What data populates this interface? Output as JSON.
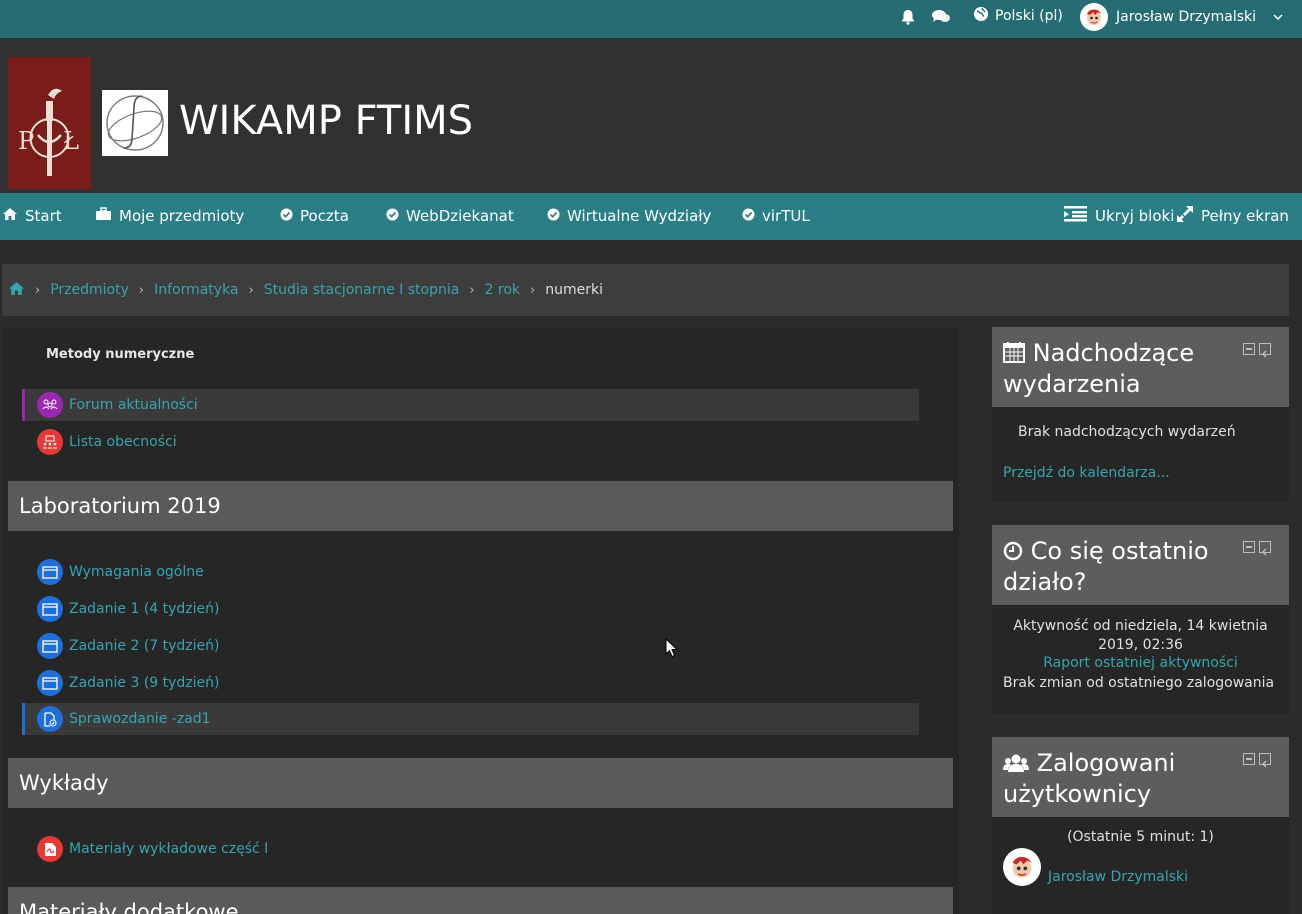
{
  "topbar": {
    "bell_icon": "bell-icon",
    "messages_icon": "chat-icon",
    "language": "Polski (pl)",
    "user_name": "Jarosław Drzymalski"
  },
  "header": {
    "site_title": "WIKAMP FTIMS",
    "logo_pl_text": "PŁ"
  },
  "nav": {
    "items": [
      {
        "label": "Start",
        "icon": "home-icon"
      },
      {
        "label": "Moje przedmioty",
        "icon": "briefcase-icon"
      },
      {
        "label": "Poczta",
        "icon": "check-circle-icon"
      },
      {
        "label": "WebDziekanat",
        "icon": "check-circle-icon"
      },
      {
        "label": "Wirtualne Wydziały",
        "icon": "check-circle-icon"
      },
      {
        "label": "virTUL",
        "icon": "check-circle-icon"
      }
    ],
    "hide_blocks": "Ukryj bloki",
    "fullscreen": "Pełny ekran"
  },
  "breadcrumb": {
    "items": [
      "Przedmioty",
      "Informatyka",
      "Studia stacjonarne I stopnia",
      "2 rok"
    ],
    "current": "numerki"
  },
  "course": {
    "top_title": "Metody numeryczne",
    "top_activities": [
      {
        "label": "Forum aktualności",
        "icon": "forum-icon",
        "color": "#9c27b0"
      },
      {
        "label": "Lista obecności",
        "icon": "attendance-icon",
        "color": "#e53935"
      }
    ],
    "sections": [
      {
        "title": "Laboratorium 2019",
        "activities": [
          {
            "label": "Wymagania ogólne",
            "icon": "page-icon",
            "color": "#1e6fd9"
          },
          {
            "label": "Zadanie 1 (4 tydzień)",
            "icon": "page-icon",
            "color": "#1e6fd9"
          },
          {
            "label": "Zadanie 2 (7 tydzień)",
            "icon": "page-icon",
            "color": "#1e6fd9"
          },
          {
            "label": "Zadanie 3 (9 tydzień)",
            "icon": "page-icon",
            "color": "#1e6fd9"
          },
          {
            "label": "Sprawozdanie -zad1",
            "icon": "assignment-icon",
            "color": "#1e6fd9"
          }
        ]
      },
      {
        "title": "Wykłady",
        "activities": [
          {
            "label": "Materiały wykładowe część I",
            "icon": "pdf-icon",
            "color": "#e53935"
          }
        ]
      },
      {
        "title": "Materiały dodatkowe",
        "activities": []
      }
    ]
  },
  "blocks": {
    "events": {
      "title_line1": "Nadchodzące",
      "title_line2": "wydarzenia",
      "empty": "Brak nadchodzących wydarzeń",
      "link": "Przejdź do kalendarza..."
    },
    "recent": {
      "title_line1": "Co się ostatnio",
      "title_line2": "działo?",
      "since_line1": "Aktywność od niedziela, 14 kwietnia",
      "since_line2": "2019, 02:36",
      "report_link": "Raport ostatniej aktywności",
      "no_changes": "Brak zmian od ostatniego zalogowania"
    },
    "online": {
      "title_line1": "Zalogowani",
      "title_line2": "użytkownicy",
      "period": "(Ostatnie 5 minut: 1)",
      "user": "Jarosław Drzymalski"
    }
  },
  "colors": {
    "accent": "#2a7f86",
    "topbar": "#256d72",
    "link": "#37a4b0"
  }
}
